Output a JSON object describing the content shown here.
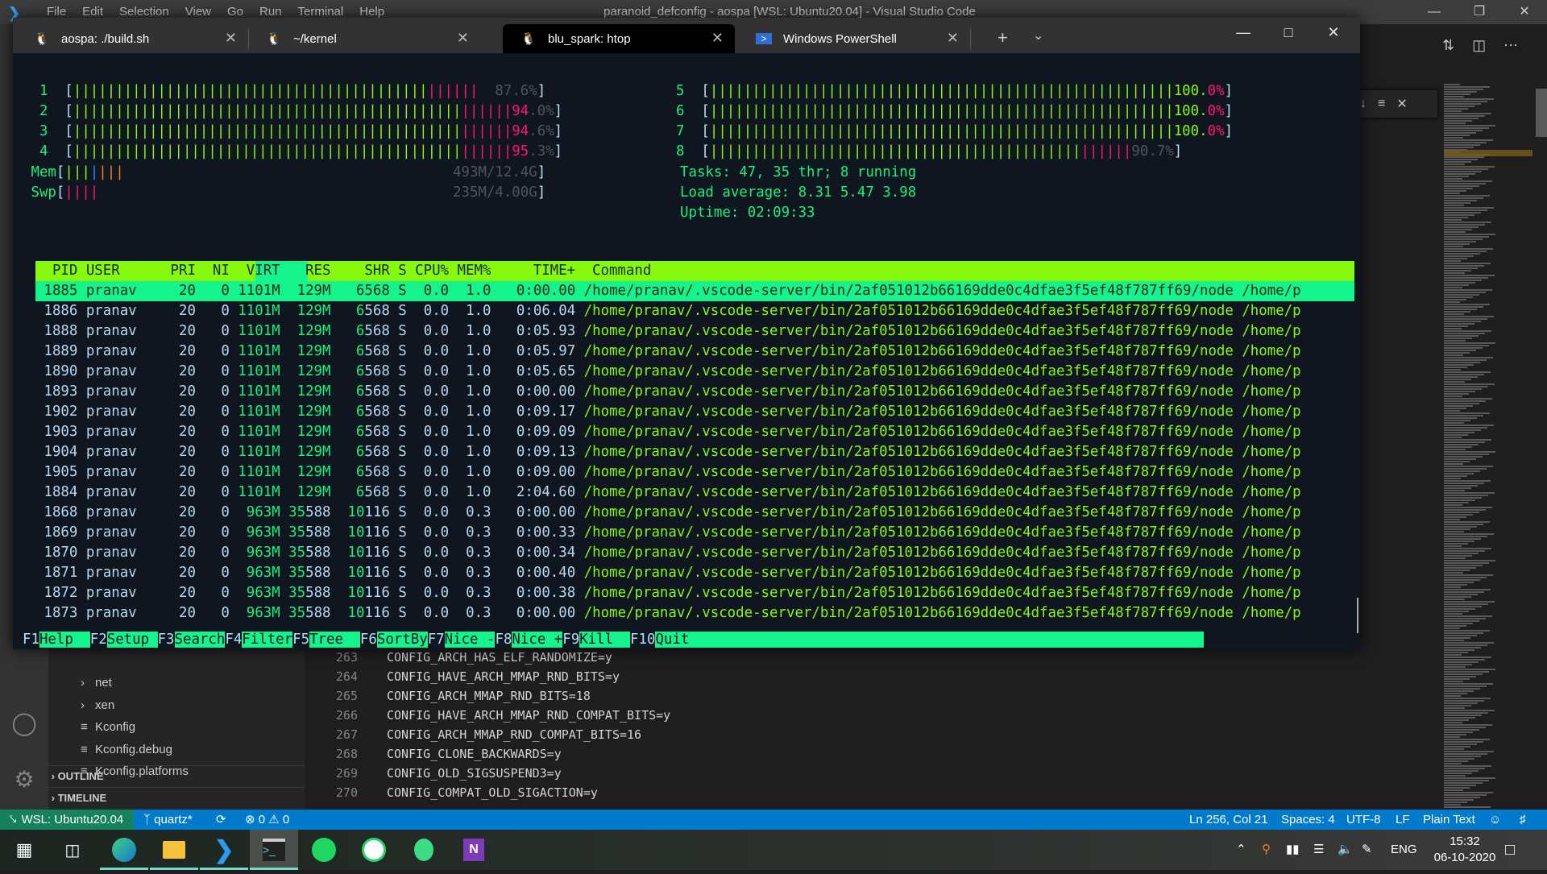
{
  "vscode": {
    "menu": [
      "File",
      "Edit",
      "Selection",
      "View",
      "Go",
      "Run",
      "Terminal",
      "Help"
    ],
    "title": "paranoid_defconfig - aospa [WSL: Ubuntu20.04] - Visual Studio Code",
    "explorer": {
      "items": [
        {
          "label": "net",
          "icon": "chevron-right"
        },
        {
          "label": "xen",
          "icon": "chevron-right"
        },
        {
          "label": "Kconfig",
          "icon": "lines"
        },
        {
          "label": "Kconfig.debug",
          "icon": "lines"
        },
        {
          "label": "Kconfig.platforms",
          "icon": "lines"
        }
      ],
      "sections": [
        "OUTLINE",
        "TIMELINE"
      ]
    },
    "code": [
      {
        "line": "263",
        "text": "CONFIG_ARCH_HAS_ELF_RANDOMIZE=y"
      },
      {
        "line": "264",
        "text": "CONFIG_HAVE_ARCH_MMAP_RND_BITS=y"
      },
      {
        "line": "265",
        "text": "CONFIG_ARCH_MMAP_RND_BITS=18"
      },
      {
        "line": "266",
        "text": "CONFIG_HAVE_ARCH_MMAP_RND_COMPAT_BITS=y"
      },
      {
        "line": "267",
        "text": "CONFIG_ARCH_MMAP_RND_COMPAT_BITS=16"
      },
      {
        "line": "268",
        "text": "CONFIG_CLONE_BACKWARDS=y"
      },
      {
        "line": "269",
        "text": "CONFIG_OLD_SIGSUSPEND3=y"
      },
      {
        "line": "270",
        "text": "CONFIG_COMPAT_OLD_SIGACTION=y"
      }
    ],
    "statusbar": {
      "remote": "WSL: Ubuntu20.04",
      "branch": "quartz*",
      "errors": "0",
      "warnings": "0",
      "position": "Ln 256, Col 21",
      "spaces": "Spaces: 4",
      "encoding": "UTF-8",
      "eol": "LF",
      "language": "Plain Text"
    }
  },
  "terminal": {
    "tabs": [
      {
        "label": "aospa: ./build.sh",
        "icon": "tux"
      },
      {
        "label": "~/kernel",
        "icon": "tux"
      },
      {
        "label": "blu_spark: htop",
        "icon": "tux",
        "active": true
      },
      {
        "label": "Windows PowerShell",
        "icon": "powershell"
      }
    ],
    "htop": {
      "cpus": [
        {
          "id": "1",
          "percent": "87.6%",
          "value": 87.6
        },
        {
          "id": "2",
          "percent": "94.0%",
          "value": 94.0
        },
        {
          "id": "3",
          "percent": "94.6%",
          "value": 94.6
        },
        {
          "id": "4",
          "percent": "95.3%",
          "value": 95.3
        },
        {
          "id": "5",
          "percent": "100.0%",
          "value": 100.0
        },
        {
          "id": "6",
          "percent": "100.0%",
          "value": 100.0
        },
        {
          "id": "7",
          "percent": "100.0%",
          "value": 100.0
        },
        {
          "id": "8",
          "percent": "90.7%",
          "value": 90.7
        }
      ],
      "mem": {
        "label": "Mem",
        "text": "493M/12.4G"
      },
      "swp": {
        "label": "Swp",
        "text": "235M/4.00G"
      },
      "tasks": "Tasks: 47, 35 thr; 8 running",
      "load": "Load average: 8.31 5.47 3.98",
      "uptime": "Uptime: 02:09:33",
      "columns": [
        "PID",
        "USER",
        "PRI",
        "NI",
        "VIRT",
        "RES",
        "SHR",
        "S",
        "CPU%",
        "MEM%",
        "TIME+",
        "Command"
      ],
      "processes": [
        [
          "1885",
          "pranav",
          "20",
          "0",
          "1101M",
          "129M",
          "6568",
          "S",
          "0.0",
          "1.0",
          "0:00.00",
          "/home/pranav/.vscode-server/bin/2af051012b66169dde0c4dfae3f5ef48f787ff69/node /home/p"
        ],
        [
          "1886",
          "pranav",
          "20",
          "0",
          "1101M",
          "129M",
          "6568",
          "S",
          "0.0",
          "1.0",
          "0:06.04",
          "/home/pranav/.vscode-server/bin/2af051012b66169dde0c4dfae3f5ef48f787ff69/node /home/p"
        ],
        [
          "1888",
          "pranav",
          "20",
          "0",
          "1101M",
          "129M",
          "6568",
          "S",
          "0.0",
          "1.0",
          "0:05.93",
          "/home/pranav/.vscode-server/bin/2af051012b66169dde0c4dfae3f5ef48f787ff69/node /home/p"
        ],
        [
          "1889",
          "pranav",
          "20",
          "0",
          "1101M",
          "129M",
          "6568",
          "S",
          "0.0",
          "1.0",
          "0:05.97",
          "/home/pranav/.vscode-server/bin/2af051012b66169dde0c4dfae3f5ef48f787ff69/node /home/p"
        ],
        [
          "1890",
          "pranav",
          "20",
          "0",
          "1101M",
          "129M",
          "6568",
          "S",
          "0.0",
          "1.0",
          "0:05.65",
          "/home/pranav/.vscode-server/bin/2af051012b66169dde0c4dfae3f5ef48f787ff69/node /home/p"
        ],
        [
          "1893",
          "pranav",
          "20",
          "0",
          "1101M",
          "129M",
          "6568",
          "S",
          "0.0",
          "1.0",
          "0:00.00",
          "/home/pranav/.vscode-server/bin/2af051012b66169dde0c4dfae3f5ef48f787ff69/node /home/p"
        ],
        [
          "1902",
          "pranav",
          "20",
          "0",
          "1101M",
          "129M",
          "6568",
          "S",
          "0.0",
          "1.0",
          "0:09.17",
          "/home/pranav/.vscode-server/bin/2af051012b66169dde0c4dfae3f5ef48f787ff69/node /home/p"
        ],
        [
          "1903",
          "pranav",
          "20",
          "0",
          "1101M",
          "129M",
          "6568",
          "S",
          "0.0",
          "1.0",
          "0:09.09",
          "/home/pranav/.vscode-server/bin/2af051012b66169dde0c4dfae3f5ef48f787ff69/node /home/p"
        ],
        [
          "1904",
          "pranav",
          "20",
          "0",
          "1101M",
          "129M",
          "6568",
          "S",
          "0.0",
          "1.0",
          "0:09.13",
          "/home/pranav/.vscode-server/bin/2af051012b66169dde0c4dfae3f5ef48f787ff69/node /home/p"
        ],
        [
          "1905",
          "pranav",
          "20",
          "0",
          "1101M",
          "129M",
          "6568",
          "S",
          "0.0",
          "1.0",
          "0:09.00",
          "/home/pranav/.vscode-server/bin/2af051012b66169dde0c4dfae3f5ef48f787ff69/node /home/p"
        ],
        [
          "1884",
          "pranav",
          "20",
          "0",
          "1101M",
          "129M",
          "6568",
          "S",
          "0.0",
          "1.0",
          "2:04.60",
          "/home/pranav/.vscode-server/bin/2af051012b66169dde0c4dfae3f5ef48f787ff69/node /home/p"
        ],
        [
          "1868",
          "pranav",
          "20",
          "0",
          "963M",
          "35588",
          "10116",
          "S",
          "0.0",
          "0.3",
          "0:00.00",
          "/home/pranav/.vscode-server/bin/2af051012b66169dde0c4dfae3f5ef48f787ff69/node /home/p"
        ],
        [
          "1869",
          "pranav",
          "20",
          "0",
          "963M",
          "35588",
          "10116",
          "S",
          "0.0",
          "0.3",
          "0:00.33",
          "/home/pranav/.vscode-server/bin/2af051012b66169dde0c4dfae3f5ef48f787ff69/node /home/p"
        ],
        [
          "1870",
          "pranav",
          "20",
          "0",
          "963M",
          "35588",
          "10116",
          "S",
          "0.0",
          "0.3",
          "0:00.34",
          "/home/pranav/.vscode-server/bin/2af051012b66169dde0c4dfae3f5ef48f787ff69/node /home/p"
        ],
        [
          "1871",
          "pranav",
          "20",
          "0",
          "963M",
          "35588",
          "10116",
          "S",
          "0.0",
          "0.3",
          "0:00.40",
          "/home/pranav/.vscode-server/bin/2af051012b66169dde0c4dfae3f5ef48f787ff69/node /home/p"
        ],
        [
          "1872",
          "pranav",
          "20",
          "0",
          "963M",
          "35588",
          "10116",
          "S",
          "0.0",
          "0.3",
          "0:00.38",
          "/home/pranav/.vscode-server/bin/2af051012b66169dde0c4dfae3f5ef48f787ff69/node /home/p"
        ],
        [
          "1873",
          "pranav",
          "20",
          "0",
          "963M",
          "35588",
          "10116",
          "S",
          "0.0",
          "0.3",
          "0:00.00",
          "/home/pranav/.vscode-server/bin/2af051012b66169dde0c4dfae3f5ef48f787ff69/node /home/p"
        ]
      ],
      "fkeys": [
        {
          "key": "F1",
          "label": "Help  "
        },
        {
          "key": "F2",
          "label": "Setup "
        },
        {
          "key": "F3",
          "label": "Search"
        },
        {
          "key": "F4",
          "label": "Filter"
        },
        {
          "key": "F5",
          "label": "Tree  "
        },
        {
          "key": "F6",
          "label": "SortBy"
        },
        {
          "key": "F7",
          "label": "Nice -"
        },
        {
          "key": "F8",
          "label": "Nice +"
        },
        {
          "key": "F9",
          "label": "Kill  "
        },
        {
          "key": "F10",
          "label": "Quit  "
        }
      ]
    }
  },
  "taskbar": {
    "apps": [
      "start",
      "task-view",
      "edge",
      "file-explorer",
      "vscode",
      "windows-terminal",
      "spotify",
      "whatsapp",
      "android-studio",
      "onenote"
    ],
    "lang": "ENG",
    "time": "15:32",
    "date": "06-10-2020"
  },
  "colors": {
    "accent_status": "#007acc",
    "remote_badge": "#16825d",
    "htop_green": "#16f27e",
    "htop_lime": "#86f90e",
    "htop_pink": "#ff1577"
  }
}
